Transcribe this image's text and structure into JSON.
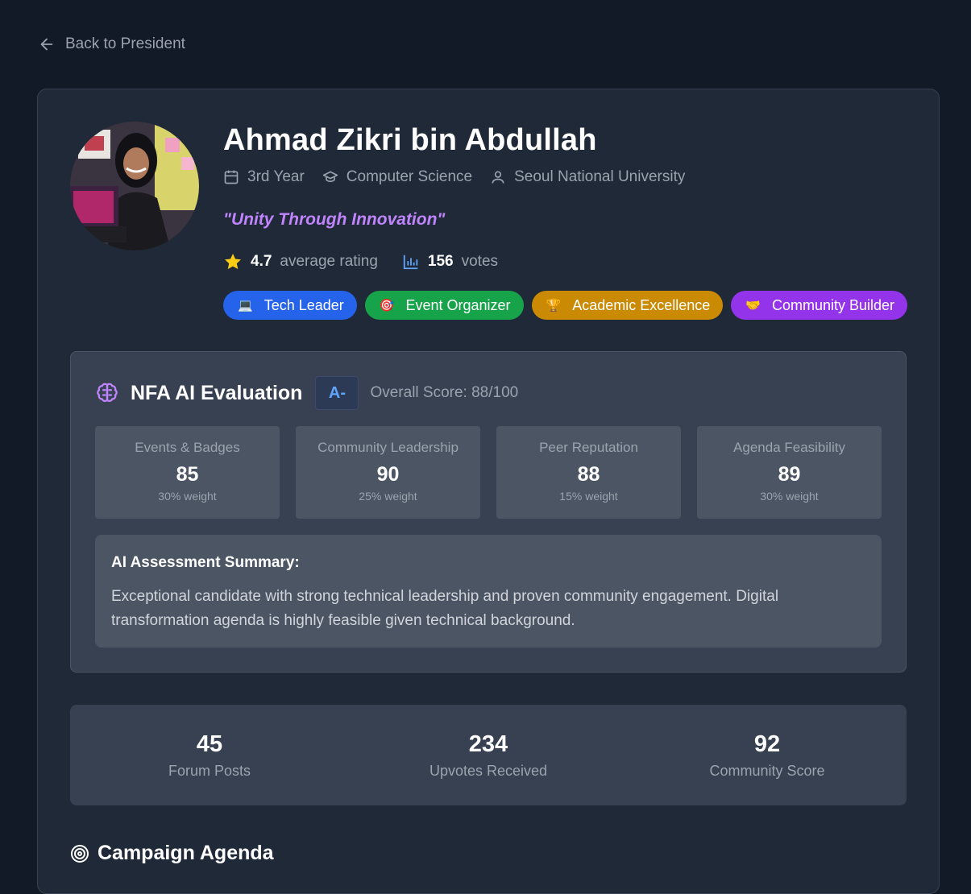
{
  "nav": {
    "back_label": "Back to President"
  },
  "candidate": {
    "name": "Ahmad Zikri bin Abdullah",
    "year": "3rd Year",
    "major": "Computer Science",
    "university": "Seoul National University",
    "slogan": "\"Unity Through Innovation\"",
    "rating": "4.7",
    "rating_label": "average rating",
    "votes": "156",
    "votes_label": "votes"
  },
  "badges": [
    {
      "label": "Tech Leader",
      "icon": "💻",
      "color": "#2563eb"
    },
    {
      "label": "Event Organizer",
      "icon": "🎯",
      "color": "#16a34a"
    },
    {
      "label": "Academic Excellence",
      "icon": "🏆",
      "color": "#ca8a04"
    },
    {
      "label": "Community Builder",
      "icon": "🤝",
      "color": "#9333ea"
    }
  ],
  "evaluation": {
    "title": "NFA AI Evaluation",
    "grade": "A-",
    "overall": "Overall Score: 88/100",
    "scores": [
      {
        "label": "Events & Badges",
        "value": "85",
        "weight": "30% weight"
      },
      {
        "label": "Community Leadership",
        "value": "90",
        "weight": "25% weight"
      },
      {
        "label": "Peer Reputation",
        "value": "88",
        "weight": "15% weight"
      },
      {
        "label": "Agenda Feasibility",
        "value": "89",
        "weight": "30% weight"
      }
    ],
    "summary_title": "AI Assessment Summary:",
    "summary_text": "Exceptional candidate with strong technical leadership and proven community engagement. Digital transformation agenda is highly feasible given technical background."
  },
  "forum": [
    {
      "value": "45",
      "label": "Forum Posts"
    },
    {
      "value": "234",
      "label": "Upvotes Received"
    },
    {
      "value": "92",
      "label": "Community Score"
    }
  ],
  "agenda": {
    "title": "Campaign Agenda"
  },
  "colors": {
    "accent_purple": "#c084fc",
    "grade_blue": "#60a5fa",
    "star": "#facc15"
  }
}
